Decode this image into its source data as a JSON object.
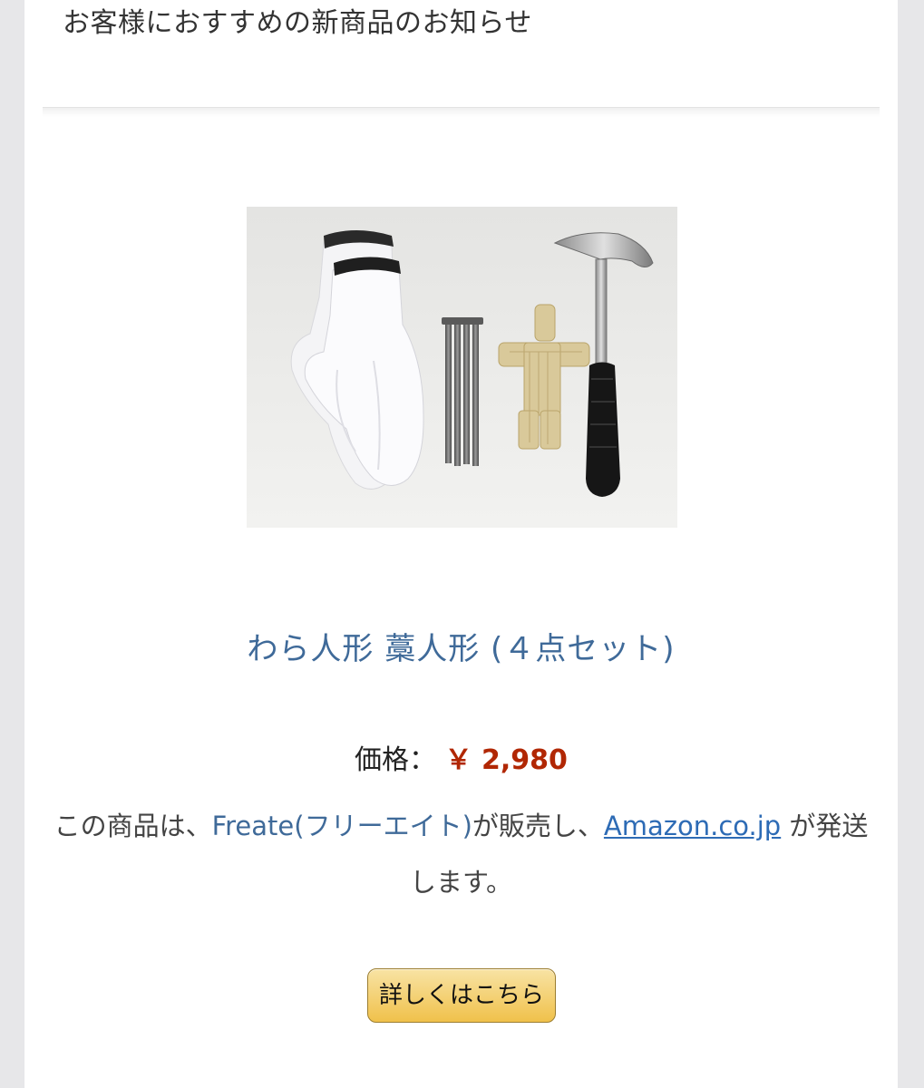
{
  "email": {
    "heading": "お客様におすすめの新商品のお知らせ"
  },
  "product": {
    "image_icon": "product-photo-icon",
    "title": "わら人形 藁人形 (４点セット)",
    "price_label": "価格：",
    "price_value": "￥ 2,980",
    "seller_prefix": "この商品は、",
    "seller_name": "Freate(フリーエイト)",
    "seller_middle": "が販売し、",
    "amazon_link": "Amazon.co.jp",
    "seller_suffix": " が発送します。",
    "details_button": "詳しくはこちら"
  },
  "colors": {
    "title": "#3f6a99",
    "price": "#b12704",
    "button": "#f0c14b",
    "link": "#2d6bb5"
  }
}
